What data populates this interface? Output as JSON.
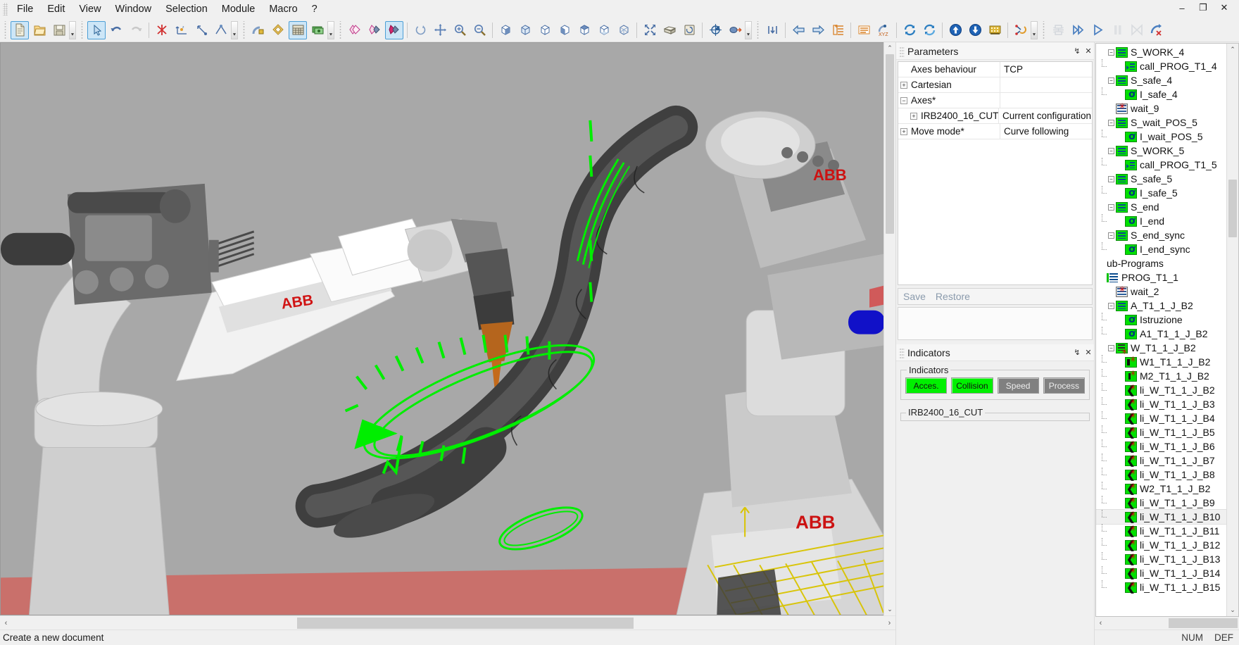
{
  "window": {
    "minimize": "–",
    "maximize": "❐",
    "close": "✕"
  },
  "menubar": {
    "items": [
      {
        "label": "File"
      },
      {
        "label": "Edit"
      },
      {
        "label": "View"
      },
      {
        "label": "Window"
      },
      {
        "label": "Selection"
      },
      {
        "label": "Module"
      },
      {
        "label": "Macro"
      },
      {
        "label": "?"
      }
    ]
  },
  "toolbar": {
    "groups": [
      {
        "name": "file",
        "buttons": [
          {
            "icon": "new-document-icon",
            "state": "active"
          },
          {
            "icon": "open-document-icon",
            "state": "normal"
          },
          {
            "icon": "save-document-icon",
            "state": "normal"
          }
        ],
        "overflow": true
      },
      {
        "name": "edit-select",
        "buttons": [
          {
            "icon": "select-pointer-icon",
            "state": "active"
          },
          {
            "icon": "undo-icon",
            "state": "normal"
          },
          {
            "icon": "redo-icon",
            "state": "disabled"
          },
          {
            "sep": true
          },
          {
            "icon": "delete-point-icon",
            "state": "normal"
          },
          {
            "icon": "move-axis-icon",
            "state": "normal"
          },
          {
            "icon": "rotate-point-icon",
            "state": "normal"
          },
          {
            "icon": "align-point-icon",
            "state": "normal"
          }
        ],
        "overflow": true
      },
      {
        "name": "robot-tools",
        "buttons": [
          {
            "icon": "robot-lock-icon",
            "state": "normal"
          },
          {
            "icon": "layers-icon",
            "state": "normal"
          },
          {
            "icon": "grid-table-icon",
            "state": "active"
          },
          {
            "icon": "money-icon",
            "state": "normal"
          }
        ],
        "overflow": true
      },
      {
        "name": "render-modes",
        "buttons": [
          {
            "icon": "copy-layer-icon",
            "state": "normal"
          },
          {
            "icon": "paste-layer-icon",
            "state": "normal"
          },
          {
            "icon": "fill-layer-icon",
            "state": "active"
          },
          {
            "sep": true
          },
          {
            "icon": "refresh-view-icon",
            "state": "normal"
          },
          {
            "icon": "pan-icon",
            "state": "normal"
          },
          {
            "icon": "zoom-in-icon",
            "state": "normal"
          },
          {
            "icon": "zoom-out-icon",
            "state": "normal"
          },
          {
            "sep": true
          },
          {
            "icon": "view-iso-icon",
            "state": "normal"
          },
          {
            "icon": "view-front-icon",
            "state": "normal"
          },
          {
            "icon": "view-back-icon",
            "state": "normal"
          },
          {
            "icon": "view-left-icon",
            "state": "normal"
          },
          {
            "icon": "view-top-icon",
            "state": "normal"
          },
          {
            "icon": "view-bottom-icon",
            "state": "normal"
          },
          {
            "icon": "view-wire-icon",
            "state": "normal"
          },
          {
            "sep": true
          },
          {
            "icon": "fit-all-icon",
            "state": "normal"
          },
          {
            "icon": "box-shade-icon",
            "state": "normal"
          },
          {
            "icon": "section-icon",
            "state": "normal"
          },
          {
            "sep": true
          },
          {
            "icon": "target-icon",
            "state": "normal"
          },
          {
            "icon": "pick-point-icon",
            "state": "normal"
          }
        ],
        "overflow": true
      },
      {
        "name": "program-nav",
        "buttons": [
          {
            "icon": "insert-step-icon",
            "state": "normal"
          },
          {
            "sep": true
          },
          {
            "icon": "arrow-left-icon",
            "state": "normal"
          },
          {
            "icon": "arrow-right-icon",
            "state": "normal"
          },
          {
            "icon": "new-list-icon",
            "state": "normal"
          },
          {
            "sep": true
          },
          {
            "icon": "list-icon",
            "state": "normal"
          },
          {
            "icon": "xyz-icon",
            "state": "normal"
          },
          {
            "sep": true
          },
          {
            "icon": "sync-icon",
            "state": "normal"
          },
          {
            "icon": "refresh-blue-icon",
            "state": "normal"
          },
          {
            "sep": true
          },
          {
            "icon": "upload-icon",
            "state": "normal"
          },
          {
            "icon": "download-icon",
            "state": "normal"
          },
          {
            "icon": "chip-icon",
            "state": "normal"
          },
          {
            "sep": true
          },
          {
            "icon": "weld-path-icon",
            "state": "normal"
          }
        ],
        "overflow": true
      },
      {
        "name": "simulation",
        "buttons": [
          {
            "icon": "simulate-icon",
            "state": "disabled"
          },
          {
            "icon": "fast-forward-icon",
            "state": "normal"
          },
          {
            "icon": "play-icon",
            "state": "normal"
          },
          {
            "icon": "pause-icon",
            "state": "disabled"
          },
          {
            "icon": "rewind-icon",
            "state": "disabled"
          },
          {
            "icon": "stop-reset-icon",
            "state": "normal"
          }
        ],
        "overflow": false
      }
    ]
  },
  "parameters_panel": {
    "title": "Parameters",
    "pin": "↯",
    "close": "✕",
    "rows": [
      {
        "expander": "",
        "indent": 0,
        "name": "Axes behaviour",
        "value": "TCP"
      },
      {
        "expander": "+",
        "indent": 0,
        "name": "Cartesian",
        "value": ""
      },
      {
        "expander": "−",
        "indent": 0,
        "name": "Axes*",
        "value": ""
      },
      {
        "expander": "+",
        "indent": 1,
        "name": "IRB2400_16_CUT",
        "value": "Current configuration"
      },
      {
        "expander": "+",
        "indent": 0,
        "name": "Move mode*",
        "value": "Curve following"
      }
    ],
    "save_label": "Save",
    "restore_label": "Restore"
  },
  "indicators_panel": {
    "title": "Indicators",
    "pin": "↯",
    "close": "✕",
    "group_label": "Indicators",
    "buttons": [
      {
        "label": "Acces.",
        "on": true,
        "color": "#00f000"
      },
      {
        "label": "Collision",
        "on": true,
        "color": "#00f000"
      },
      {
        "label": "Speed",
        "on": false,
        "color": "#808080"
      },
      {
        "label": "Process",
        "on": false,
        "color": "#808080"
      }
    ],
    "progress_label": "IRB2400_16_CUT",
    "progress_value": 0
  },
  "tree_panel": {
    "nodes": [
      {
        "label": "S_WORK_4",
        "depth": 0,
        "expander": "−",
        "icon": "program-block-icon",
        "icon_class": "ic-lines"
      },
      {
        "label": "call_PROG_T1_4",
        "depth": 1,
        "expander": "",
        "icon": "call-program-icon",
        "icon_class": "ic-call"
      },
      {
        "label": "S_safe_4",
        "depth": 0,
        "expander": "−",
        "icon": "program-block-icon",
        "icon_class": "ic-lines"
      },
      {
        "label": "I_safe_4",
        "depth": 1,
        "expander": "",
        "icon": "instruction-icon",
        "icon_class": "ic-inst"
      },
      {
        "label": "wait_9",
        "depth": 0,
        "expander": "",
        "icon": "wait-icon",
        "icon_class": "ic-wait"
      },
      {
        "label": "S_wait_POS_5",
        "depth": 0,
        "expander": "−",
        "icon": "program-block-icon",
        "icon_class": "ic-lines"
      },
      {
        "label": "I_wait_POS_5",
        "depth": 1,
        "expander": "",
        "icon": "instruction-icon",
        "icon_class": "ic-inst"
      },
      {
        "label": "S_WORK_5",
        "depth": 0,
        "expander": "−",
        "icon": "program-block-icon",
        "icon_class": "ic-lines"
      },
      {
        "label": "call_PROG_T1_5",
        "depth": 1,
        "expander": "",
        "icon": "call-program-icon",
        "icon_class": "ic-call"
      },
      {
        "label": "S_safe_5",
        "depth": 0,
        "expander": "−",
        "icon": "program-block-icon",
        "icon_class": "ic-lines"
      },
      {
        "label": "I_safe_5",
        "depth": 1,
        "expander": "",
        "icon": "instruction-icon",
        "icon_class": "ic-inst"
      },
      {
        "label": "S_end",
        "depth": 0,
        "expander": "−",
        "icon": "program-block-icon",
        "icon_class": "ic-lines"
      },
      {
        "label": "I_end",
        "depth": 1,
        "expander": "",
        "icon": "instruction-icon",
        "icon_class": "ic-inst"
      },
      {
        "label": "S_end_sync",
        "depth": 0,
        "expander": "−",
        "icon": "program-block-icon",
        "icon_class": "ic-lines"
      },
      {
        "label": "I_end_sync",
        "depth": 1,
        "expander": "",
        "icon": "instruction-icon",
        "icon_class": "ic-inst"
      },
      {
        "label": "ub-Programs",
        "depth": -1,
        "expander": "",
        "icon": "",
        "icon_class": "none"
      },
      {
        "label": "PROG_T1_1",
        "depth": -1,
        "expander": "",
        "icon": "program-icon",
        "icon_class": "ic-prog"
      },
      {
        "label": "wait_2",
        "depth": 0,
        "expander": "",
        "icon": "wait-icon",
        "icon_class": "ic-wait"
      },
      {
        "label": "A_T1_1_J_B2",
        "depth": 0,
        "expander": "−",
        "icon": "program-block-icon",
        "icon_class": "ic-lines"
      },
      {
        "label": "Istruzione",
        "depth": 1,
        "expander": "",
        "icon": "instruction-icon",
        "icon_class": "ic-inst"
      },
      {
        "label": "A1_T1_1_J_B2",
        "depth": 1,
        "expander": "",
        "icon": "instruction-icon",
        "icon_class": "ic-inst"
      },
      {
        "label": "W_T1_1_J_B2",
        "depth": 0,
        "expander": "−",
        "icon": "work-block-icon",
        "icon_class": "ic-work"
      },
      {
        "label": "W1_T1_1_J_B2",
        "depth": 1,
        "expander": "",
        "icon": "weld-start-icon",
        "icon_class": "ic-w1"
      },
      {
        "label": "M2_T1_1_J_B2",
        "depth": 1,
        "expander": "",
        "icon": "move-point-icon",
        "icon_class": "ic-m2"
      },
      {
        "label": "li_W_T1_1_J_B2",
        "depth": 1,
        "expander": "",
        "icon": "linear-point-icon",
        "icon_class": "ic-li"
      },
      {
        "label": "li_W_T1_1_J_B3",
        "depth": 1,
        "expander": "",
        "icon": "linear-point-icon",
        "icon_class": "ic-li"
      },
      {
        "label": "li_W_T1_1_J_B4",
        "depth": 1,
        "expander": "",
        "icon": "linear-point-icon",
        "icon_class": "ic-li"
      },
      {
        "label": "li_W_T1_1_J_B5",
        "depth": 1,
        "expander": "",
        "icon": "linear-point-icon",
        "icon_class": "ic-li"
      },
      {
        "label": "li_W_T1_1_J_B6",
        "depth": 1,
        "expander": "",
        "icon": "linear-point-icon",
        "icon_class": "ic-li"
      },
      {
        "label": "li_W_T1_1_J_B7",
        "depth": 1,
        "expander": "",
        "icon": "linear-point-icon",
        "icon_class": "ic-li"
      },
      {
        "label": "li_W_T1_1_J_B8",
        "depth": 1,
        "expander": "",
        "icon": "linear-point-icon",
        "icon_class": "ic-li"
      },
      {
        "label": "W2_T1_1_J_B2",
        "depth": 1,
        "expander": "",
        "icon": "linear-point-icon",
        "icon_class": "ic-li"
      },
      {
        "label": "li_W_T1_1_J_B9",
        "depth": 1,
        "expander": "",
        "icon": "linear-point-icon",
        "icon_class": "ic-li"
      },
      {
        "label": "li_W_T1_1_J_B10",
        "depth": 1,
        "expander": "",
        "icon": "linear-point-icon",
        "icon_class": "ic-li",
        "hover": true
      },
      {
        "label": "li_W_T1_1_J_B11",
        "depth": 1,
        "expander": "",
        "icon": "linear-point-icon",
        "icon_class": "ic-li"
      },
      {
        "label": "li_W_T1_1_J_B12",
        "depth": 1,
        "expander": "",
        "icon": "linear-point-icon",
        "icon_class": "ic-li"
      },
      {
        "label": "li_W_T1_1_J_B13",
        "depth": 1,
        "expander": "",
        "icon": "linear-point-icon",
        "icon_class": "ic-li"
      },
      {
        "label": "li_W_T1_1_J_B14",
        "depth": 1,
        "expander": "",
        "icon": "linear-point-icon",
        "icon_class": "ic-li"
      },
      {
        "label": "li_W_T1_1_J_B15",
        "depth": 1,
        "expander": "",
        "icon": "linear-point-icon",
        "icon_class": "ic-li"
      }
    ]
  },
  "statusbar": {
    "message": "Create a new document",
    "num": "NUM",
    "def": "DEF"
  },
  "scrollbars": {
    "up": "⌃",
    "down": "⌄",
    "left": "‹",
    "right": "›"
  },
  "viewport": {
    "background": "#a8a8a8",
    "floor_color": "#c16a66",
    "path_color": "#00ff00",
    "grid_color": "#cfc000",
    "robot_brand": "ABB"
  }
}
